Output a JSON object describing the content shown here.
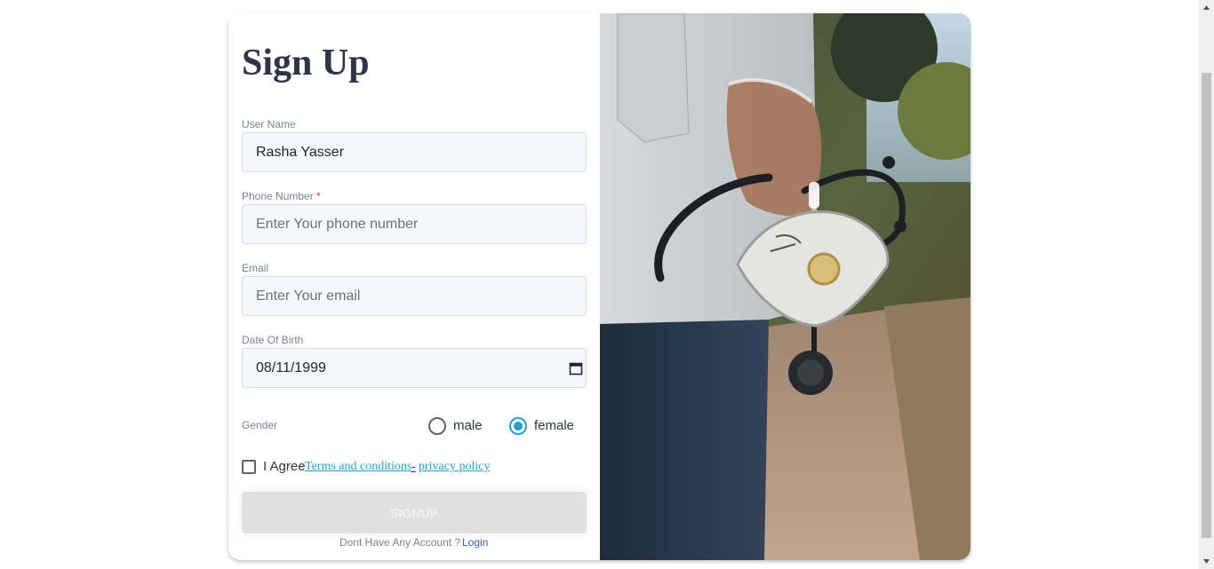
{
  "form": {
    "title": "Sign Up",
    "username": {
      "label": "User Name",
      "value": "Rasha Yasser"
    },
    "phone": {
      "label": "Phone Number",
      "required_mark": "*",
      "placeholder": "Enter Your phone number",
      "value": ""
    },
    "email": {
      "label": "Email",
      "placeholder": "Enter Your email",
      "value": ""
    },
    "dob": {
      "label": "Date Of Birth",
      "value": "08/11/1999"
    },
    "gender": {
      "label": "Gender",
      "options": [
        {
          "label": "male",
          "selected": false
        },
        {
          "label": "female",
          "selected": true
        }
      ]
    },
    "agree": {
      "checked": false,
      "prefix": "I Agree",
      "terms_link": "Terms and conditions",
      "separator": "-",
      "privacy_link": "privacy policy"
    },
    "signup_label": "SignUp",
    "account_prompt": "Dont Have Any Account ?",
    "login_link": "Login"
  },
  "colors": {
    "accent": "#1ba3d1",
    "title": "#2d3546",
    "label": "#7b8292",
    "input_bg": "#f6f7fd",
    "button_disabled": "#e0e0e0",
    "link": "#2a63c0"
  }
}
